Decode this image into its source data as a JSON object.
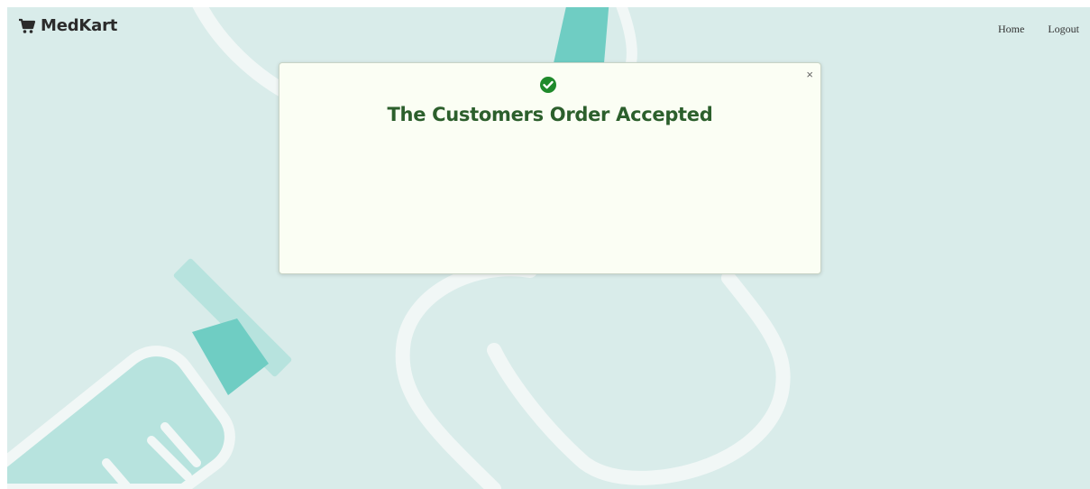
{
  "navbar": {
    "brand": "MedKart",
    "brand_icon": "cart-icon",
    "links": [
      {
        "label": "Home"
      },
      {
        "label": "Logout"
      }
    ]
  },
  "modal": {
    "icon": "check-circle-icon",
    "title": "The Customers Order Accepted",
    "close_label": "×"
  },
  "colors": {
    "background": "#d9ecea",
    "accent_teal": "#6fcdc3",
    "modal_bg": "#fbfef4",
    "success_green": "#1f8a2b",
    "title_green": "#2c5f2c"
  }
}
